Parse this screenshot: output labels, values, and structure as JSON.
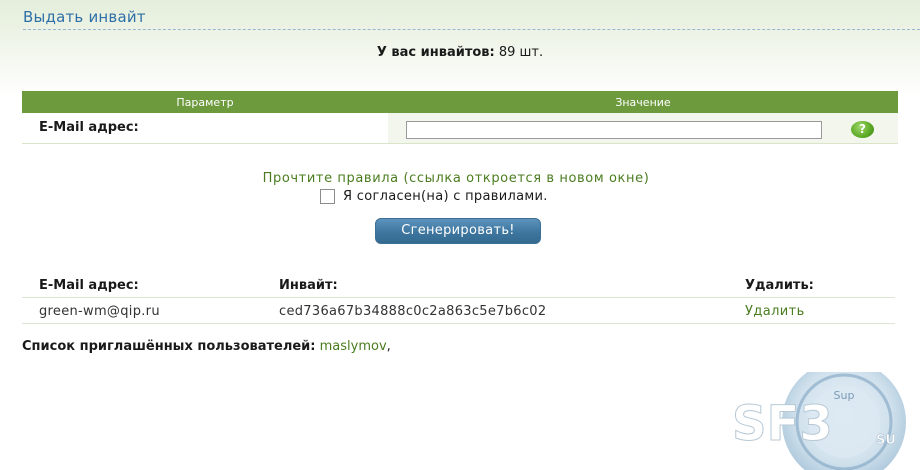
{
  "header": {
    "title": "Выдать инвайт"
  },
  "invites": {
    "count_label": "У вас инвайтов:",
    "count_value": "89 шт."
  },
  "param_table": {
    "col_param": "Параметр",
    "col_value": "Значение",
    "email_label": "E-Mail адрес:",
    "email_value": "",
    "help_icon": "question-icon",
    "help_glyph": "?"
  },
  "rules": {
    "link_text": "Прочтите правила (ссылка откроется в новом окне)",
    "agree_label": "Я согласен(на) с правилами.",
    "agree_checked": false
  },
  "generate_button": "Сгенерировать!",
  "invites_table": {
    "headers": [
      "E-Mail адрес:",
      "Инвайт:",
      "Удалить:"
    ],
    "rows": [
      {
        "email": "green-wm@qip.ru",
        "invite": "ced736a67b34888c0c2a863c5e7b6c02",
        "delete": "Удалить"
      }
    ]
  },
  "invited_users": {
    "label": "Список приглашённых пользователей:",
    "users": [
      "maslymov"
    ],
    "separator": ","
  },
  "watermark": {
    "text": "SF3",
    "suffix": "SU",
    "top_text": "Sup"
  },
  "colors": {
    "accent_green": "#6e9a3e",
    "link_green": "#4a7c1f",
    "title_blue": "#2e6fa7",
    "button_blue": "#3d769f"
  }
}
